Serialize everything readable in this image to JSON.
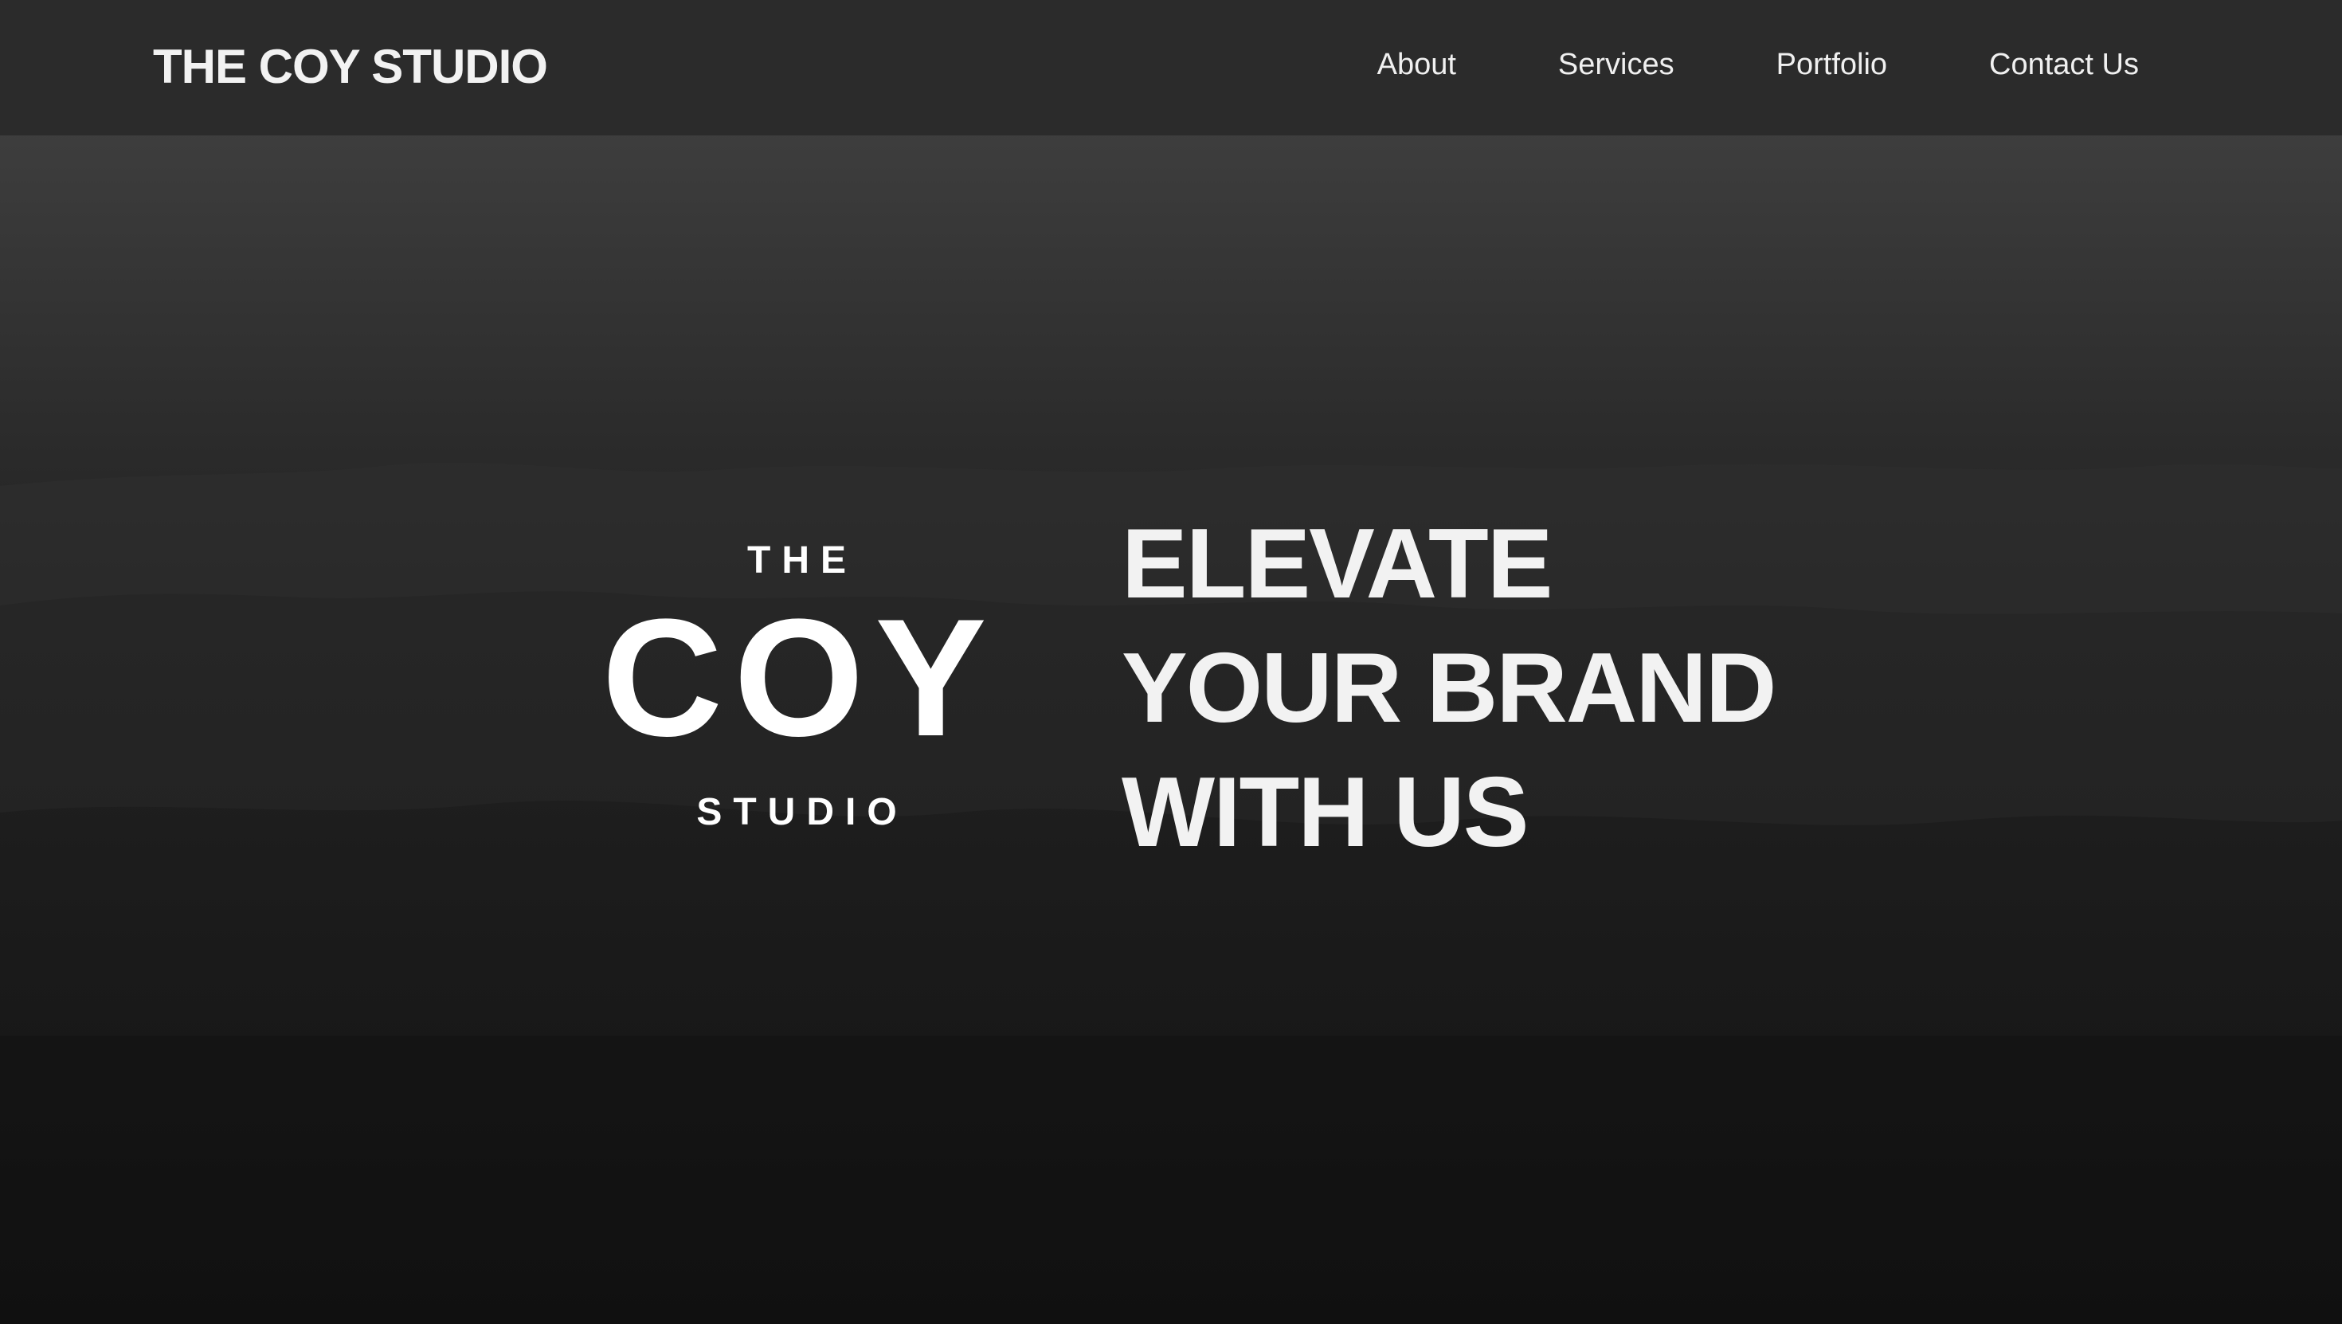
{
  "header": {
    "brand": "THE COY STUDIO",
    "nav": [
      {
        "label": "About"
      },
      {
        "label": "Services"
      },
      {
        "label": "Portfolio"
      },
      {
        "label": "Contact Us"
      }
    ]
  },
  "hero": {
    "logo": {
      "top": "THE",
      "middle": "COY",
      "bottom": "STUDIO"
    },
    "tagline": [
      "ELEVATE",
      "YOUR BRAND",
      "WITH US"
    ]
  },
  "colors": {
    "navbar": "#2b2b2b",
    "text": "#f2f2f2",
    "background": "#1a1a1a"
  }
}
